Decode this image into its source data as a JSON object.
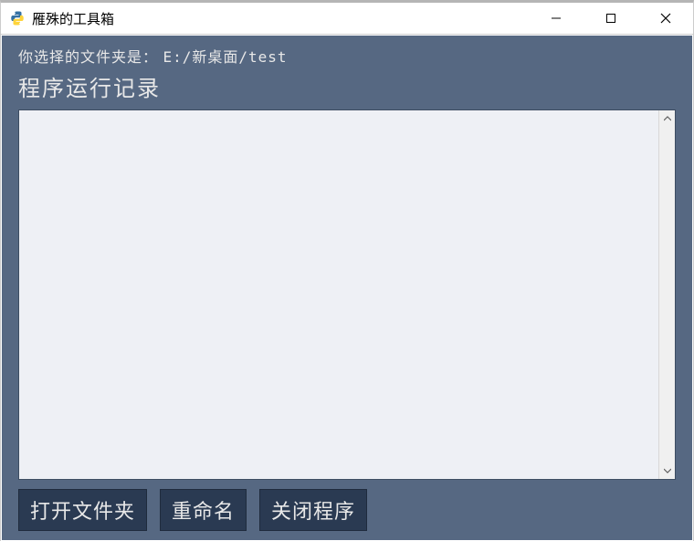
{
  "window": {
    "title": "雁殊的工具箱"
  },
  "content": {
    "folder_label": "你选择的文件夹是：",
    "folder_path": "E:/新桌面/test",
    "log_title": "程序运行记录",
    "log_text": ""
  },
  "buttons": {
    "open_folder": "打开文件夹",
    "rename": "重命名",
    "close_program": "关闭程序"
  }
}
